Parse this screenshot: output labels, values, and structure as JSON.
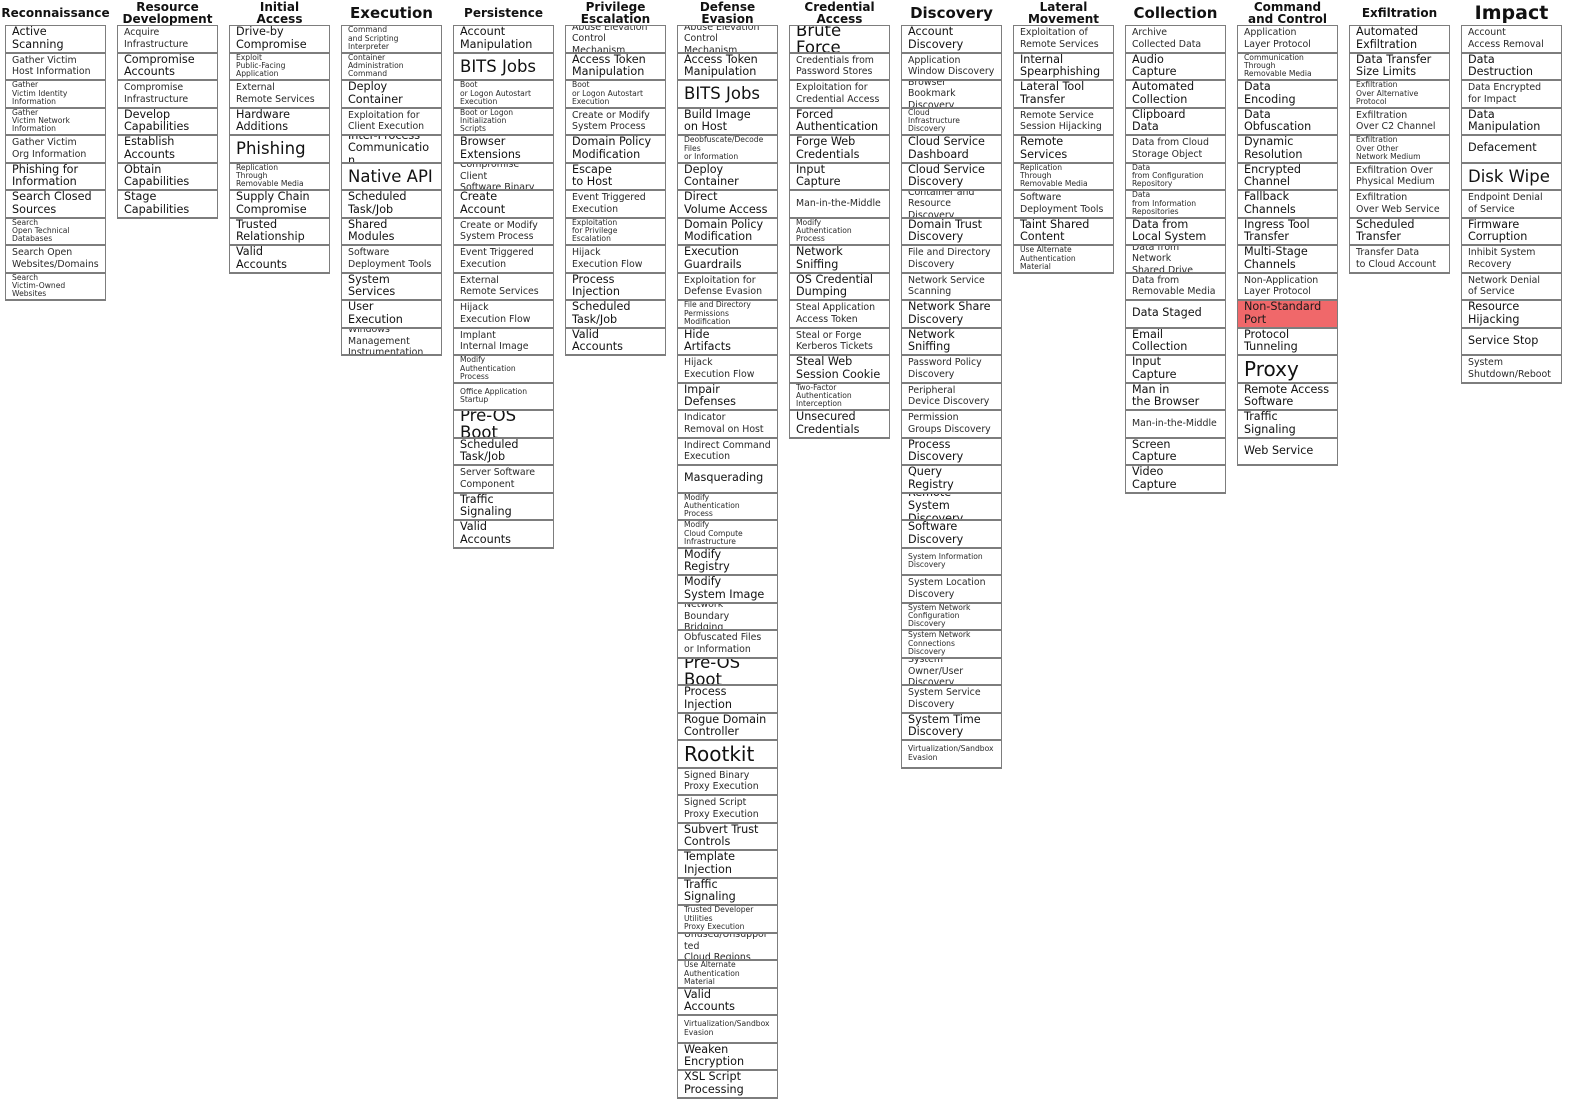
{
  "highlight_color": "#f0686a",
  "tactics": [
    {
      "slug": "reconnaissance",
      "name": "Reconnaissance",
      "size": "small",
      "techniques": [
        {
          "t": "Active\nScanning"
        },
        {
          "t": "Gather Victim\nHost Information",
          "s": "s"
        },
        {
          "t": "Gather\nVictim Identity\nInformation",
          "s": "xs"
        },
        {
          "t": "Gather\nVictim Network\nInformation",
          "s": "xs"
        },
        {
          "t": "Gather Victim\nOrg Information",
          "s": "s"
        },
        {
          "t": "Phishing for\nInformation"
        },
        {
          "t": "Search Closed\nSources"
        },
        {
          "t": "Search\nOpen Technical\nDatabases",
          "s": "xs"
        },
        {
          "t": "Search Open\nWebsites/Domains",
          "s": "s"
        },
        {
          "t": "Search\nVictim-Owned\nWebsites",
          "s": "xs"
        }
      ]
    },
    {
      "slug": "resource-development",
      "name": "Resource\nDevelopment",
      "size": "small",
      "techniques": [
        {
          "t": "Acquire\nInfrastructure",
          "s": "s"
        },
        {
          "t": "Compromise\nAccounts"
        },
        {
          "t": "Compromise\nInfrastructure",
          "s": "s"
        },
        {
          "t": "Develop\nCapabilities"
        },
        {
          "t": "Establish\nAccounts"
        },
        {
          "t": "Obtain\nCapabilities"
        },
        {
          "t": "Stage\nCapabilities"
        }
      ]
    },
    {
      "slug": "initial-access",
      "name": "Initial\nAccess",
      "size": "small",
      "techniques": [
        {
          "t": "Drive-by\nCompromise"
        },
        {
          "t": "Exploit\nPublic-Facing\nApplication",
          "s": "xs"
        },
        {
          "t": "External\nRemote Services",
          "s": "s"
        },
        {
          "t": "Hardware\nAdditions"
        },
        {
          "t": "Phishing",
          "s": "l"
        },
        {
          "t": "Replication\nThrough\nRemovable Media",
          "s": "xs"
        },
        {
          "t": "Supply Chain\nCompromise"
        },
        {
          "t": "Trusted\nRelationship"
        },
        {
          "t": "Valid\nAccounts"
        }
      ]
    },
    {
      "slug": "execution",
      "name": "Execution",
      "size": "med",
      "techniques": [
        {
          "t": "Command\nand Scripting\nInterpreter",
          "s": "xs"
        },
        {
          "t": "Container\nAdministration\nCommand",
          "s": "xs"
        },
        {
          "t": "Deploy\nContainer"
        },
        {
          "t": "Exploitation for\nClient Execution",
          "s": "s"
        },
        {
          "t": "Inter-Process\nCommunication"
        },
        {
          "t": "Native API",
          "s": "l"
        },
        {
          "t": "Scheduled\nTask/Job"
        },
        {
          "t": "Shared\nModules"
        },
        {
          "t": "Software\nDeployment Tools",
          "s": "s"
        },
        {
          "t": "System\nServices"
        },
        {
          "t": "User\nExecution"
        },
        {
          "t": "Windows Management\nInstrumentation",
          "s": "s"
        }
      ]
    },
    {
      "slug": "persistence",
      "name": "Persistence",
      "size": "small",
      "techniques": [
        {
          "t": "Account\nManipulation"
        },
        {
          "t": "BITS Jobs",
          "s": "l"
        },
        {
          "t": "Boot\nor Logon Autostart\nExecution",
          "s": "xs"
        },
        {
          "t": "Boot or Logon\nInitialization\nScripts",
          "s": "xs"
        },
        {
          "t": "Browser\nExtensions"
        },
        {
          "t": "Compromise Client\nSoftware Binary",
          "s": "s"
        },
        {
          "t": "Create\nAccount"
        },
        {
          "t": "Create or Modify\nSystem Process",
          "s": "s"
        },
        {
          "t": "Event Triggered\nExecution",
          "s": "s"
        },
        {
          "t": "External\nRemote Services",
          "s": "s"
        },
        {
          "t": "Hijack\nExecution Flow",
          "s": "s"
        },
        {
          "t": "Implant\nInternal Image",
          "s": "s"
        },
        {
          "t": "Modify\nAuthentication\nProcess",
          "s": "xs"
        },
        {
          "t": "Office Application\nStartup",
          "s": "xs"
        },
        {
          "t": "Pre-OS Boot",
          "s": "l"
        },
        {
          "t": "Scheduled\nTask/Job"
        },
        {
          "t": "Server Software\nComponent",
          "s": "s"
        },
        {
          "t": "Traffic\nSignaling"
        },
        {
          "t": "Valid\nAccounts"
        }
      ]
    },
    {
      "slug": "privilege-escalation",
      "name": "Privilege\nEscalation",
      "size": "small",
      "techniques": [
        {
          "t": "Abuse Elevation\nControl Mechanism",
          "s": "s"
        },
        {
          "t": "Access Token\nManipulation"
        },
        {
          "t": "Boot\nor Logon Autostart\nExecution",
          "s": "xs"
        },
        {
          "t": "Create or Modify\nSystem Process",
          "s": "s"
        },
        {
          "t": "Domain Policy\nModification"
        },
        {
          "t": "Escape\nto Host"
        },
        {
          "t": "Event Triggered\nExecution",
          "s": "s"
        },
        {
          "t": "Exploitation\nfor Privilege\nEscalation",
          "s": "xs"
        },
        {
          "t": "Hijack\nExecution Flow",
          "s": "s"
        },
        {
          "t": "Process\nInjection"
        },
        {
          "t": "Scheduled\nTask/Job"
        },
        {
          "t": "Valid\nAccounts"
        }
      ]
    },
    {
      "slug": "defense-evasion",
      "name": "Defense\nEvasion",
      "size": "small",
      "techniques": [
        {
          "t": "Abuse Elevation\nControl Mechanism",
          "s": "s"
        },
        {
          "t": "Access Token\nManipulation"
        },
        {
          "t": "BITS Jobs",
          "s": "l"
        },
        {
          "t": "Build Image\non Host"
        },
        {
          "t": "Deobfuscate/Decode\nFiles\nor Information",
          "s": "xs"
        },
        {
          "t": "Deploy\nContainer"
        },
        {
          "t": "Direct\nVolume Access"
        },
        {
          "t": "Domain Policy\nModification"
        },
        {
          "t": "Execution\nGuardrails"
        },
        {
          "t": "Exploitation for\nDefense Evasion",
          "s": "s"
        },
        {
          "t": "File and Directory\nPermissions\nModification",
          "s": "xs"
        },
        {
          "t": "Hide\nArtifacts"
        },
        {
          "t": "Hijack\nExecution Flow",
          "s": "s"
        },
        {
          "t": "Impair\nDefenses"
        },
        {
          "t": "Indicator\nRemoval on Host",
          "s": "s"
        },
        {
          "t": "Indirect Command\nExecution",
          "s": "s"
        },
        {
          "t": "Masquerading"
        },
        {
          "t": "Modify\nAuthentication\nProcess",
          "s": "xs"
        },
        {
          "t": "Modify\nCloud Compute\nInfrastructure",
          "s": "xs"
        },
        {
          "t": "Modify\nRegistry"
        },
        {
          "t": "Modify\nSystem Image"
        },
        {
          "t": "Network Boundary\nBridging",
          "s": "s"
        },
        {
          "t": "Obfuscated Files\nor Information",
          "s": "s"
        },
        {
          "t": "Pre-OS Boot",
          "s": "l"
        },
        {
          "t": "Process\nInjection"
        },
        {
          "t": "Rogue Domain\nController"
        },
        {
          "t": "Rootkit",
          "s": "xl"
        },
        {
          "t": "Signed Binary\nProxy Execution",
          "s": "s"
        },
        {
          "t": "Signed Script\nProxy Execution",
          "s": "s"
        },
        {
          "t": "Subvert Trust\nControls"
        },
        {
          "t": "Template\nInjection"
        },
        {
          "t": "Traffic\nSignaling"
        },
        {
          "t": "Trusted Developer\nUtilities\nProxy Execution",
          "s": "xs"
        },
        {
          "t": "Unused/Unsupported\nCloud Regions",
          "s": "s"
        },
        {
          "t": "Use Alternate\nAuthentication\nMaterial",
          "s": "xs"
        },
        {
          "t": "Valid\nAccounts"
        },
        {
          "t": "Virtualization/Sandbox\nEvasion",
          "s": "xs"
        },
        {
          "t": "Weaken\nEncryption"
        },
        {
          "t": "XSL Script\nProcessing"
        }
      ]
    },
    {
      "slug": "credential-access",
      "name": "Credential\nAccess",
      "size": "small",
      "techniques": [
        {
          "t": "Brute Force",
          "s": "l"
        },
        {
          "t": "Credentials from\nPassword Stores",
          "s": "s"
        },
        {
          "t": "Exploitation for\nCredential Access",
          "s": "s"
        },
        {
          "t": "Forced\nAuthentication"
        },
        {
          "t": "Forge Web\nCredentials"
        },
        {
          "t": "Input\nCapture"
        },
        {
          "t": "Man-in-the-Middle",
          "s": "s"
        },
        {
          "t": "Modify\nAuthentication\nProcess",
          "s": "xs"
        },
        {
          "t": "Network\nSniffing"
        },
        {
          "t": "OS Credential\nDumping"
        },
        {
          "t": "Steal Application\nAccess Token",
          "s": "s"
        },
        {
          "t": "Steal or Forge\nKerberos Tickets",
          "s": "s"
        },
        {
          "t": "Steal Web\nSession Cookie"
        },
        {
          "t": "Two-Factor\nAuthentication\nInterception",
          "s": "xs"
        },
        {
          "t": "Unsecured\nCredentials"
        }
      ]
    },
    {
      "slug": "discovery",
      "name": "Discovery",
      "size": "med",
      "techniques": [
        {
          "t": "Account\nDiscovery"
        },
        {
          "t": "Application\nWindow Discovery",
          "s": "s"
        },
        {
          "t": "Browser Bookmark\nDiscovery",
          "s": "s"
        },
        {
          "t": "Cloud\nInfrastructure\nDiscovery",
          "s": "xs"
        },
        {
          "t": "Cloud Service\nDashboard"
        },
        {
          "t": "Cloud Service\nDiscovery"
        },
        {
          "t": "Container and\nResource Discovery",
          "s": "s"
        },
        {
          "t": "Domain Trust\nDiscovery"
        },
        {
          "t": "File and Directory\nDiscovery",
          "s": "s"
        },
        {
          "t": "Network Service\nScanning",
          "s": "s"
        },
        {
          "t": "Network Share\nDiscovery"
        },
        {
          "t": "Network\nSniffing"
        },
        {
          "t": "Password Policy\nDiscovery",
          "s": "s"
        },
        {
          "t": "Peripheral\nDevice Discovery",
          "s": "s"
        },
        {
          "t": "Permission\nGroups Discovery",
          "s": "s"
        },
        {
          "t": "Process\nDiscovery"
        },
        {
          "t": "Query\nRegistry"
        },
        {
          "t": "Remote System\nDiscovery"
        },
        {
          "t": "Software\nDiscovery"
        },
        {
          "t": "System Information\nDiscovery",
          "s": "xs"
        },
        {
          "t": "System Location\nDiscovery",
          "s": "s"
        },
        {
          "t": "System Network\nConfiguration\nDiscovery",
          "s": "xs"
        },
        {
          "t": "System Network\nConnections\nDiscovery",
          "s": "xs"
        },
        {
          "t": "System Owner/User\nDiscovery",
          "s": "s"
        },
        {
          "t": "System Service\nDiscovery",
          "s": "s"
        },
        {
          "t": "System Time\nDiscovery"
        },
        {
          "t": "Virtualization/Sandbox\nEvasion",
          "s": "xs"
        }
      ]
    },
    {
      "slug": "lateral-movement",
      "name": "Lateral\nMovement",
      "size": "small",
      "techniques": [
        {
          "t": "Exploitation of\nRemote Services",
          "s": "s"
        },
        {
          "t": "Internal\nSpearphishing"
        },
        {
          "t": "Lateral Tool\nTransfer"
        },
        {
          "t": "Remote Service\nSession Hijacking",
          "s": "s"
        },
        {
          "t": "Remote\nServices"
        },
        {
          "t": "Replication\nThrough\nRemovable Media",
          "s": "xs"
        },
        {
          "t": "Software\nDeployment Tools",
          "s": "s"
        },
        {
          "t": "Taint Shared\nContent"
        },
        {
          "t": "Use Alternate\nAuthentication\nMaterial",
          "s": "xs"
        }
      ]
    },
    {
      "slug": "collection",
      "name": "Collection",
      "size": "med",
      "techniques": [
        {
          "t": "Archive\nCollected Data",
          "s": "s"
        },
        {
          "t": "Audio\nCapture"
        },
        {
          "t": "Automated\nCollection"
        },
        {
          "t": "Clipboard\nData"
        },
        {
          "t": "Data from Cloud\nStorage Object",
          "s": "s"
        },
        {
          "t": "Data\nfrom Configuration\nRepository",
          "s": "xs"
        },
        {
          "t": "Data\nfrom Information\nRepositories",
          "s": "xs"
        },
        {
          "t": "Data from\nLocal System"
        },
        {
          "t": "Data from Network\nShared Drive",
          "s": "s"
        },
        {
          "t": "Data from\nRemovable Media",
          "s": "s"
        },
        {
          "t": "Data Staged"
        },
        {
          "t": "Email\nCollection"
        },
        {
          "t": "Input\nCapture"
        },
        {
          "t": "Man in\nthe Browser"
        },
        {
          "t": "Man-in-the-Middle",
          "s": "s"
        },
        {
          "t": "Screen\nCapture"
        },
        {
          "t": "Video\nCapture"
        }
      ]
    },
    {
      "slug": "command-and-control",
      "name": "Command\nand Control",
      "size": "small",
      "techniques": [
        {
          "t": "Application\nLayer Protocol",
          "s": "s"
        },
        {
          "t": "Communication\nThrough\nRemovable Media",
          "s": "xs"
        },
        {
          "t": "Data\nEncoding"
        },
        {
          "t": "Data\nObfuscation"
        },
        {
          "t": "Dynamic\nResolution"
        },
        {
          "t": "Encrypted\nChannel"
        },
        {
          "t": "Fallback\nChannels"
        },
        {
          "t": "Ingress Tool\nTransfer"
        },
        {
          "t": "Multi-Stage\nChannels"
        },
        {
          "t": "Non-Application\nLayer Protocol",
          "s": "s"
        },
        {
          "t": "Non-Standard\nPort",
          "hl": true
        },
        {
          "t": "Protocol\nTunneling"
        },
        {
          "t": "Proxy",
          "s": "xl"
        },
        {
          "t": "Remote Access\nSoftware"
        },
        {
          "t": "Traffic\nSignaling"
        },
        {
          "t": "Web Service"
        }
      ]
    },
    {
      "slug": "exfiltration",
      "name": "Exfiltration",
      "size": "small",
      "techniques": [
        {
          "t": "Automated\nExfiltration"
        },
        {
          "t": "Data Transfer\nSize Limits"
        },
        {
          "t": "Exfiltration\nOver Alternative\nProtocol",
          "s": "xs"
        },
        {
          "t": "Exfiltration\nOver C2 Channel",
          "s": "s"
        },
        {
          "t": "Exfiltration\nOver Other\nNetwork Medium",
          "s": "xs"
        },
        {
          "t": "Exfiltration Over\nPhysical Medium",
          "s": "s"
        },
        {
          "t": "Exfiltration\nOver Web Service",
          "s": "s"
        },
        {
          "t": "Scheduled\nTransfer"
        },
        {
          "t": "Transfer Data\nto Cloud Account",
          "s": "s"
        }
      ]
    },
    {
      "slug": "impact",
      "name": "Impact",
      "size": "big",
      "techniques": [
        {
          "t": "Account\nAccess Removal",
          "s": "s"
        },
        {
          "t": "Data\nDestruction"
        },
        {
          "t": "Data Encrypted\nfor Impact",
          "s": "s"
        },
        {
          "t": "Data\nManipulation"
        },
        {
          "t": "Defacement"
        },
        {
          "t": "Disk Wipe",
          "s": "l"
        },
        {
          "t": "Endpoint Denial\nof Service",
          "s": "s"
        },
        {
          "t": "Firmware\nCorruption"
        },
        {
          "t": "Inhibit System\nRecovery",
          "s": "s"
        },
        {
          "t": "Network Denial\nof Service",
          "s": "s"
        },
        {
          "t": "Resource\nHijacking"
        },
        {
          "t": "Service Stop"
        },
        {
          "t": "System\nShutdown/Reboot",
          "s": "s"
        }
      ]
    }
  ]
}
